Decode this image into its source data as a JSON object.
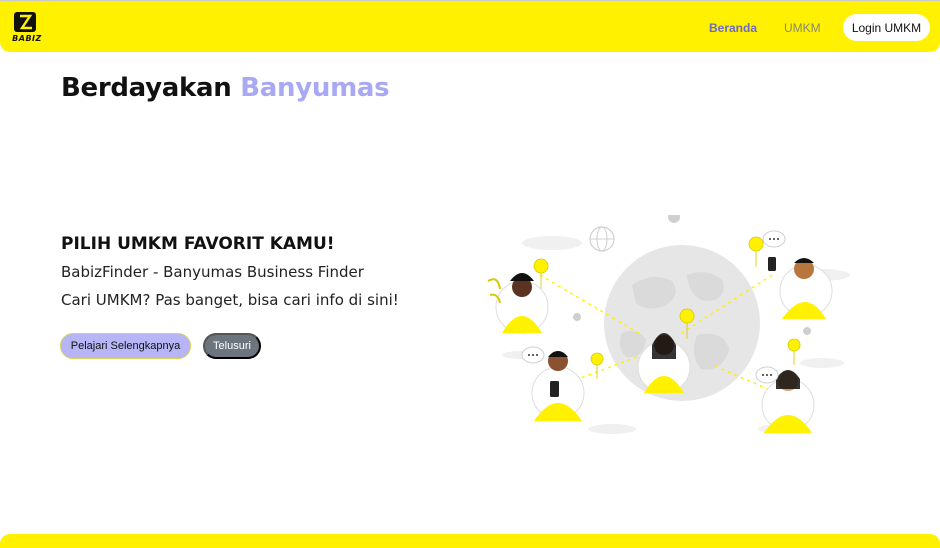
{
  "nav": {
    "logo_text": "BABIZ",
    "home_label": "Beranda",
    "umkm_label": "UMKM",
    "login_label": "Login UMKM"
  },
  "hero": {
    "title_main": "Berdayakan",
    "title_accent": "Banyumas",
    "heading": "PILIH UMKM FAVORIT KAMU!",
    "subtitle": "BabizFinder - Banyumas Business Finder",
    "tagline": "Cari UMKM? Pas banget, bisa cari info di sini!",
    "learn_more_label": "Pelajari Selengkapnya",
    "browse_label": "Telusuri"
  },
  "colors": {
    "brand_yellow": "#fff100",
    "accent_lavender": "#a9a8f2",
    "button_gray": "#6c757d"
  }
}
